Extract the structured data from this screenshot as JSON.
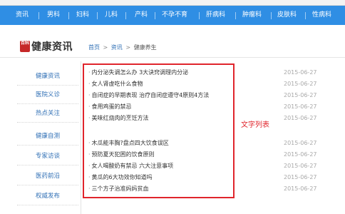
{
  "nav": {
    "items": [
      "资讯",
      "男科",
      "妇科",
      "儿科",
      "产科",
      "不孕不育",
      "肝病科",
      "肿瘤科",
      "皮肤科",
      "性病科"
    ]
  },
  "logo": {
    "mark": "百科",
    "text": "健康资讯"
  },
  "breadcrumb": {
    "home": "首页",
    "section": "资讯",
    "current": "健康养生",
    "separator": ">"
  },
  "sidebar": {
    "items": [
      "健康资讯",
      "医院义诊",
      "热点关注",
      "健康自测",
      "专家访谈",
      "医药前沿",
      "权威发布"
    ]
  },
  "articles": [
    {
      "title": "内分泌失调怎么办 3大诀窍调理内分泌",
      "date": "2015-06-27"
    },
    {
      "title": "女人肾虚吃什么食物",
      "date": "2015-06-27"
    },
    {
      "title": "自闭症的早期表现 治疗自闭症遵守4原则4方法",
      "date": "2015-06-27"
    },
    {
      "title": "食用鸡蛋的禁忌",
      "date": "2015-06-27"
    },
    {
      "title": "美味红烧肉的烹饪方法",
      "date": "2015-06-27"
    },
    {
      "title": "木瓜能丰胸?盘点四大饮食误区",
      "date": "2015-06-27"
    },
    {
      "title": "预防夏天犯困的饮食原则",
      "date": "2015-06-27"
    },
    {
      "title": "女人喝酸奶有禁忌 六大注意事项",
      "date": "2015-06-27"
    },
    {
      "title": "黄瓜的6大功效你知道吗",
      "date": "2015-06-27"
    },
    {
      "title": "三个方子治准妈妈贫血",
      "date": "2015-06-27"
    }
  ],
  "annotation": {
    "label": "文字列表",
    "color": "#e0252c"
  },
  "colors": {
    "nav_bg": "#2f8ee4",
    "link": "#2f6fb5",
    "date": "#a8a8a8"
  }
}
